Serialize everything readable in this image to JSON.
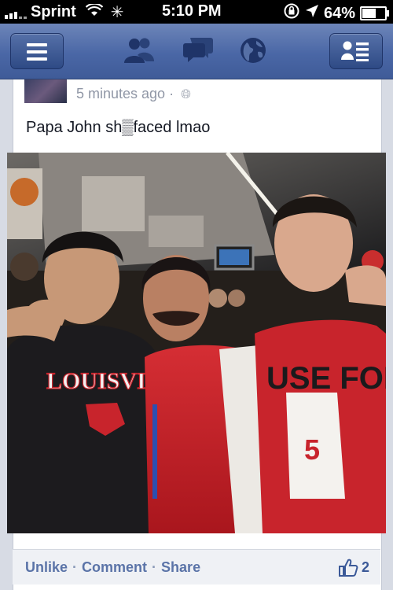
{
  "status_bar": {
    "carrier": "Sprint",
    "time": "5:10 PM",
    "battery": "64%",
    "battery_level": 0.64,
    "icons": [
      "signal-icon",
      "wifi-icon",
      "activity-spinner-icon",
      "rotation-lock-icon",
      "location-arrow-icon",
      "battery-icon"
    ]
  },
  "nav": {
    "icons": [
      "menu-icon",
      "friends-icon",
      "messages-icon",
      "globe-icon",
      "profile-list-icon"
    ],
    "color": "#3b5998"
  },
  "post": {
    "timestamp": "5 minutes ago",
    "separator": "·",
    "text": "Papa John sh▒faced lmao",
    "shirt_text_left": "LOUISVILLE",
    "shirt_text_right": "USE FOR",
    "jersey_number": "5"
  },
  "actions": {
    "unlike": "Unlike",
    "comment": "Comment",
    "share": "Share",
    "dot": "·",
    "like_count": "2"
  },
  "colors": {
    "facebook_blue": "#3b5998",
    "link_blue": "#5b74a8",
    "louisville_red": "#c8242c"
  }
}
